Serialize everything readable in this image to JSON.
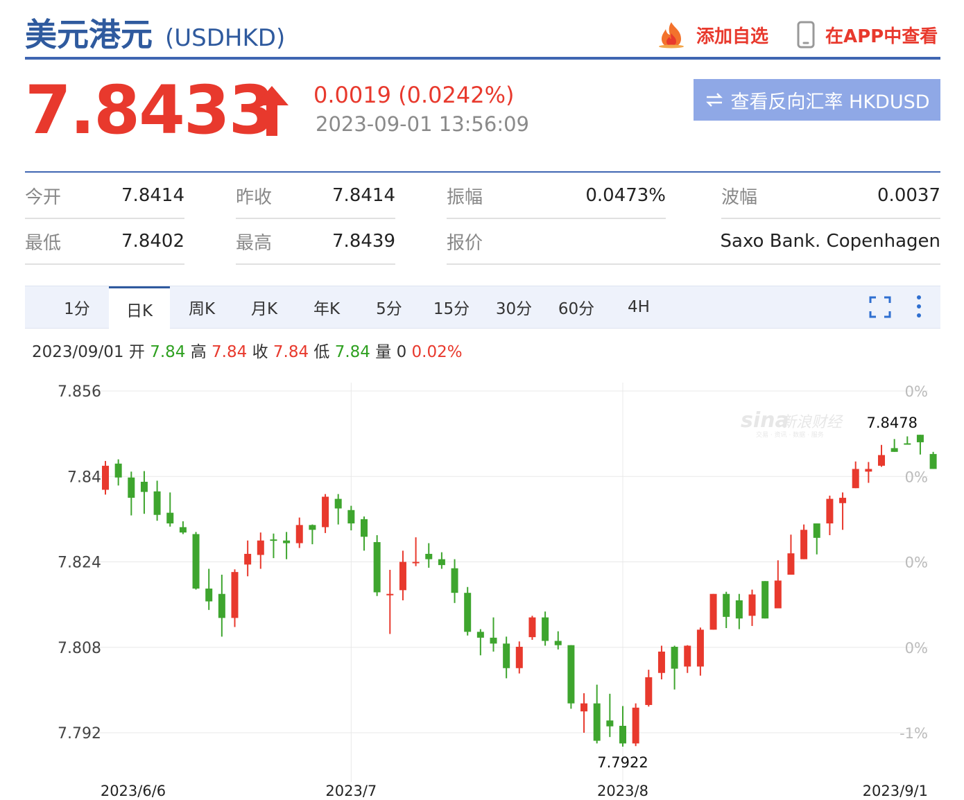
{
  "header": {
    "title": "美元港元",
    "code": "(USDHKD)",
    "add_watch": "添加自选",
    "view_app": "在APP中查看"
  },
  "quote": {
    "price": "7.8433",
    "change": "0.0019 (0.0242%)",
    "time": "2023-09-01 13:56:09",
    "reverse_button": "查看反向汇率 HKDUSD"
  },
  "stats": [
    {
      "label": "今开",
      "value": "7.8414"
    },
    {
      "label": "昨收",
      "value": "7.8414"
    },
    {
      "label": "振幅",
      "value": "0.0473%"
    },
    {
      "label": "波幅",
      "value": "0.0037"
    },
    {
      "label": "最低",
      "value": "7.8402"
    },
    {
      "label": "最高",
      "value": "7.8439"
    },
    {
      "label": "报价",
      "value": "Saxo Bank. Copenhagen"
    }
  ],
  "tabs": [
    "1分",
    "日K",
    "周K",
    "月K",
    "年K",
    "5分",
    "15分",
    "30分",
    "60分",
    "4H"
  ],
  "active_tab": "日K",
  "bar_info": {
    "date": "2023/09/01",
    "open_label": "开",
    "open": "7.84",
    "high_label": "高",
    "high": "7.84",
    "close_label": "收",
    "close": "7.84",
    "low_label": "低",
    "low": "7.84",
    "vol_label": "量",
    "vol": "0",
    "pct": "0.02%"
  },
  "watermark": {
    "brand": "sina",
    "name": "新浪财经",
    "sub": "交易 · 资讯 · 数据 · 服务"
  },
  "colors": {
    "up": "#e8392d",
    "down": "#3ea52e",
    "accent": "#3f66b2"
  },
  "chart_data": {
    "type": "candlestick",
    "ylim": [
      7.788,
      7.858
    ],
    "y_ticks": [
      "7.856",
      "7.84",
      "7.824",
      "7.808",
      "7.792"
    ],
    "right_ticks": [
      "0%",
      "0%",
      "0%",
      "0%",
      "-1%"
    ],
    "x_labels": [
      {
        "label": "2023/6/6",
        "index": 0
      },
      {
        "label": "2023/7",
        "index": 19
      },
      {
        "label": "2023/8",
        "index": 40
      },
      {
        "label": "2023/9/1",
        "index": 63
      }
    ],
    "max_label": "7.8478",
    "min_label": "7.7922",
    "candles": [
      [
        7.8375,
        7.842,
        7.8366,
        7.8429
      ],
      [
        7.8424,
        7.8398,
        7.8383,
        7.8432
      ],
      [
        7.8398,
        7.836,
        7.8327,
        7.8409
      ],
      [
        7.839,
        7.8371,
        7.833,
        7.841
      ],
      [
        7.8372,
        7.8328,
        7.8317,
        7.8392
      ],
      [
        7.8332,
        7.8312,
        7.8306,
        7.837
      ],
      [
        7.8305,
        7.8295,
        7.8292,
        7.8316
      ],
      [
        7.8292,
        7.819,
        7.8188,
        7.8296
      ],
      [
        7.819,
        7.8166,
        7.815,
        7.8227
      ],
      [
        7.818,
        7.8135,
        7.81,
        7.8216
      ],
      [
        7.8135,
        7.8221,
        7.8118,
        7.8226
      ],
      [
        7.8235,
        7.8255,
        7.8213,
        7.828
      ],
      [
        7.8253,
        7.828,
        7.8227,
        7.8295
      ],
      [
        7.8282,
        7.828,
        7.8247,
        7.8293
      ],
      [
        7.828,
        7.8275,
        7.8245,
        7.8296
      ],
      [
        7.8275,
        7.8309,
        7.8266,
        7.8323
      ],
      [
        7.8309,
        7.83,
        7.8273,
        7.831
      ],
      [
        7.8305,
        7.8362,
        7.8294,
        7.8367
      ],
      [
        7.8358,
        7.834,
        7.831,
        7.8367
      ],
      [
        7.8337,
        7.8312,
        7.8299,
        7.8345
      ],
      [
        7.832,
        7.8287,
        7.8261,
        7.8325
      ],
      [
        7.8277,
        7.8183,
        7.8176,
        7.829
      ],
      [
        7.818,
        7.818,
        7.8105,
        7.8225
      ],
      [
        7.8187,
        7.824,
        7.8168,
        7.8261
      ],
      [
        7.824,
        7.824,
        7.8232,
        7.8286
      ],
      [
        7.8255,
        7.8245,
        7.8229,
        7.8275
      ],
      [
        7.8245,
        7.8234,
        7.8227,
        7.8258
      ],
      [
        7.8228,
        7.8182,
        7.8163,
        7.8245
      ],
      [
        7.8182,
        7.8109,
        7.8102,
        7.8193
      ],
      [
        7.8109,
        7.8098,
        7.8065,
        7.8114
      ],
      [
        7.8098,
        7.8087,
        7.8072,
        7.8136
      ],
      [
        7.8087,
        7.8041,
        7.8022,
        7.81
      ],
      [
        7.8041,
        7.8081,
        7.8031,
        7.8091
      ],
      [
        7.8099,
        7.8136,
        7.8094,
        7.8139
      ],
      [
        7.8136,
        7.8092,
        7.8083,
        7.8147
      ],
      [
        7.8092,
        7.8084,
        7.8076,
        7.811
      ],
      [
        7.8084,
        7.7975,
        7.7965,
        7.8084
      ],
      [
        7.796,
        7.7975,
        7.792,
        7.7994
      ],
      [
        7.7975,
        7.7905,
        7.79,
        7.801
      ],
      [
        7.7943,
        7.7932,
        7.7912,
        7.7993
      ],
      [
        7.7933,
        7.79,
        7.7894,
        7.797
      ],
      [
        7.79,
        7.7967,
        7.7895,
        7.7975
      ],
      [
        7.7972,
        7.8024,
        7.7969,
        7.8038
      ],
      [
        7.8032,
        7.8072,
        7.802,
        7.8083
      ],
      [
        7.8081,
        7.804,
        7.8001,
        7.8083
      ],
      [
        7.8044,
        7.8083,
        7.8032,
        7.8084
      ],
      [
        7.8044,
        7.8113,
        7.8027,
        7.8117
      ],
      [
        7.8113,
        7.818,
        7.8119,
        7.8138
      ],
      [
        7.818,
        7.8137,
        7.8116,
        7.8184
      ],
      [
        7.8168,
        7.8134,
        7.8114,
        7.818
      ],
      [
        7.8139,
        7.8179,
        7.812,
        7.8188
      ],
      [
        7.8204,
        7.8134,
        7.8154,
        7.82
      ],
      [
        7.8153,
        7.8205,
        7.8162,
        7.8243
      ],
      [
        7.8216,
        7.8256,
        7.8291,
        7.8251
      ],
      [
        7.8245,
        7.83,
        7.8278,
        7.831
      ],
      [
        7.8312,
        7.8285,
        7.8254,
        7.8306
      ],
      [
        7.8312,
        7.8358,
        7.8364,
        7.829
      ],
      [
        7.835,
        7.836,
        7.837,
        7.83
      ],
      [
        7.8378,
        7.8414,
        7.8387,
        7.8428
      ],
      [
        7.8409,
        7.8414,
        7.8388,
        7.8427
      ],
      [
        7.842,
        7.844,
        7.8418,
        7.8459
      ],
      [
        7.8453,
        7.8446,
        7.8463,
        7.847
      ],
      [
        7.8462,
        7.846,
        7.8475,
        7.846
      ],
      [
        7.8478,
        7.8464,
        7.8441,
        7.8468
      ],
      [
        7.8442,
        7.8414,
        7.8446,
        7.8433
      ]
    ]
  }
}
